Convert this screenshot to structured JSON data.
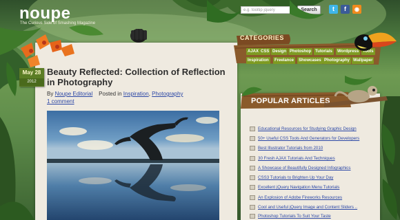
{
  "site": {
    "logo": "noupe",
    "tagline": "The Curious Side of Smashing Magazine"
  },
  "search": {
    "placeholder": "e.g. tooltip jquery",
    "button_label": "Search"
  },
  "social": [
    {
      "name": "twitter",
      "glyph": "t",
      "color": "#3fb6e8"
    },
    {
      "name": "facebook",
      "glyph": "f",
      "color": "#3b5b98"
    },
    {
      "name": "rss",
      "glyph": "◉",
      "color": "#f08a1d"
    }
  ],
  "post": {
    "month_day": "May 28",
    "year": "2012",
    "title": "Beauty Reflected: Collection of Reflection in Photography",
    "by_label": "By",
    "author": "Noupe Editorial",
    "posted_in_label": "Posted in",
    "category_1": "Inspiration",
    "separator": ",",
    "category_2": "Photography",
    "comments": "1 comment"
  },
  "categories": {
    "title": "CATEGORIES",
    "row1": [
      "AJAX",
      "CSS",
      "Design",
      "Photoshop",
      "Tutorials",
      "Wordpress",
      "Tools"
    ],
    "row2": [
      "Inspiration",
      "Freelance",
      "Showcases",
      "Photography",
      "Wallpaper"
    ]
  },
  "popular": {
    "title": "POPULAR ARTICLES",
    "items": [
      "Educational Resources for Studying Graphic Design",
      "50+ Useful CSS Tools And Generators for Developers",
      "Best Illustrator Tutorials from 2010",
      "30 Fresh AJAX Tutorials And Techniques",
      "A Showcase of Beautifully Designed Infographics",
      "CSS3 Tutorials to Brighten Up Your Day",
      "Excellent jQuery Navigation Menu Tutorials",
      "An Explosion of Adobe Fireworks Resources",
      "Cool and Useful jQuery Image and Content Sliders ..",
      "Photoshop Tutorials To Suit Your Taste"
    ]
  },
  "colors": {
    "accent_green": "#7e9b22",
    "date_green": "#5b7d25",
    "link_blue": "#2b47a6",
    "wood_brown": "#8a5a2b"
  }
}
